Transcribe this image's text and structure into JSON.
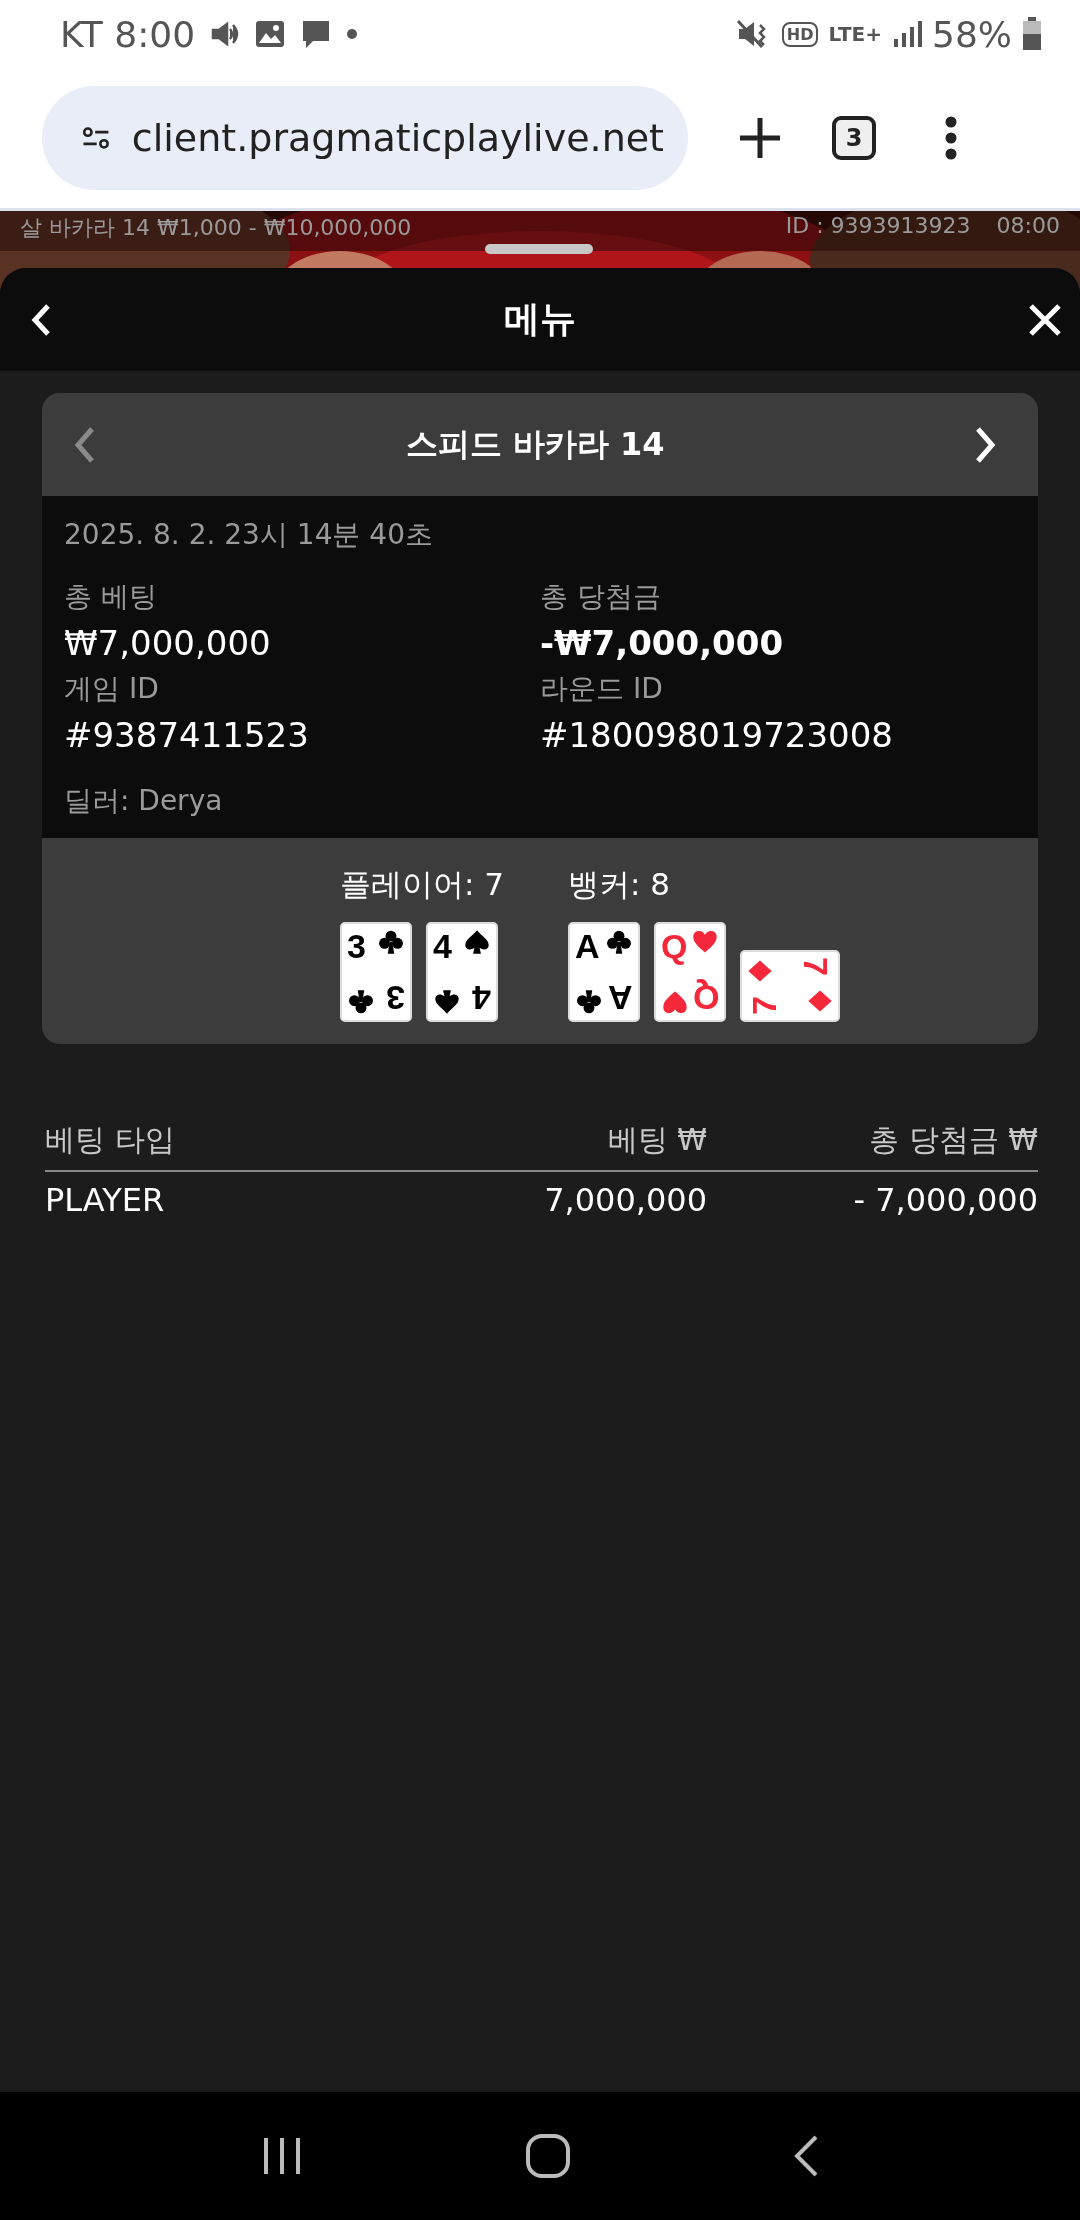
{
  "status_bar": {
    "time": "KT 8:00",
    "hd_badge": "HD",
    "network": "LTE+",
    "battery": "58%"
  },
  "browser": {
    "url": "client.pragmaticplaylive.net",
    "tab_count": "3"
  },
  "game_strip": {
    "table_limits": "살 바카라 14 ₩1,000 - ₩10,000,000",
    "game_id": "ID : 9393913923",
    "clock": "08:00"
  },
  "sheet": {
    "title": "메뉴"
  },
  "round": {
    "title": "스피드 바카라 14",
    "prev_disabled": true,
    "next_disabled": false,
    "date": "2025. 8. 2. 23시 14분 40초",
    "fields": [
      {
        "label": "총 베팅",
        "value": "₩7,000,000",
        "emphasis": false
      },
      {
        "label": "총 당첨금",
        "value": "-₩7,000,000",
        "emphasis": true
      },
      {
        "label": "게임 ID",
        "value": "#9387411523",
        "emphasis": false
      },
      {
        "label": "라운드 ID",
        "value": "#180098019723008",
        "emphasis": false
      }
    ],
    "dealer": "딜러: Derya",
    "hands": [
      {
        "label": "플레이어: 7",
        "cards": [
          {
            "ranks": [
              "3",
              "3"
            ],
            "kind": "clubs",
            "rotated": false
          },
          {
            "ranks": [
              "4",
              "4"
            ],
            "kind": "spades",
            "rotated": false
          }
        ]
      },
      {
        "label": "뱅커: 8",
        "cards": [
          {
            "ranks": [
              "A",
              "A"
            ],
            "kind": "clubs",
            "rotated": false
          },
          {
            "ranks": [
              "Q",
              "Q"
            ],
            "kind": "hearts",
            "rotated": false
          },
          {
            "ranks": [
              "7",
              "7"
            ],
            "kind": "diamonds",
            "rotated": true
          }
        ]
      }
    ]
  },
  "bets_table": {
    "columns": [
      "베팅 타입",
      "베팅 ₩",
      "총 당첨금 ₩"
    ],
    "rows": [
      [
        "PLAYER",
        "7,000,000",
        "- 7,000,000"
      ]
    ]
  }
}
